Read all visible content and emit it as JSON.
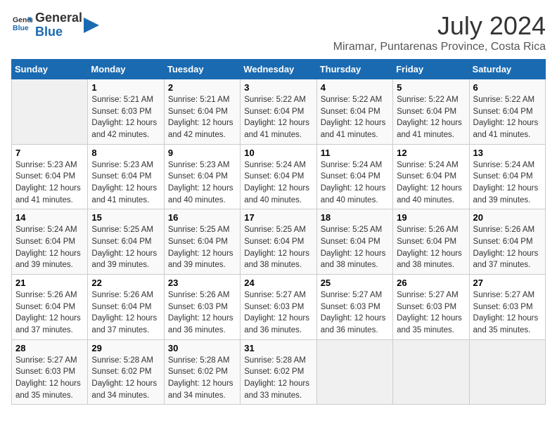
{
  "logo": {
    "line1": "General",
    "line2": "Blue"
  },
  "title": "July 2024",
  "location": "Miramar, Puntarenas Province, Costa Rica",
  "days_of_week": [
    "Sunday",
    "Monday",
    "Tuesday",
    "Wednesday",
    "Thursday",
    "Friday",
    "Saturday"
  ],
  "weeks": [
    [
      {
        "day": "",
        "sunrise": "",
        "sunset": "",
        "daylight": ""
      },
      {
        "day": "1",
        "sunrise": "Sunrise: 5:21 AM",
        "sunset": "Sunset: 6:03 PM",
        "daylight": "Daylight: 12 hours and 42 minutes."
      },
      {
        "day": "2",
        "sunrise": "Sunrise: 5:21 AM",
        "sunset": "Sunset: 6:04 PM",
        "daylight": "Daylight: 12 hours and 42 minutes."
      },
      {
        "day": "3",
        "sunrise": "Sunrise: 5:22 AM",
        "sunset": "Sunset: 6:04 PM",
        "daylight": "Daylight: 12 hours and 41 minutes."
      },
      {
        "day": "4",
        "sunrise": "Sunrise: 5:22 AM",
        "sunset": "Sunset: 6:04 PM",
        "daylight": "Daylight: 12 hours and 41 minutes."
      },
      {
        "day": "5",
        "sunrise": "Sunrise: 5:22 AM",
        "sunset": "Sunset: 6:04 PM",
        "daylight": "Daylight: 12 hours and 41 minutes."
      },
      {
        "day": "6",
        "sunrise": "Sunrise: 5:22 AM",
        "sunset": "Sunset: 6:04 PM",
        "daylight": "Daylight: 12 hours and 41 minutes."
      }
    ],
    [
      {
        "day": "7",
        "sunrise": "Sunrise: 5:23 AM",
        "sunset": "Sunset: 6:04 PM",
        "daylight": "Daylight: 12 hours and 41 minutes."
      },
      {
        "day": "8",
        "sunrise": "Sunrise: 5:23 AM",
        "sunset": "Sunset: 6:04 PM",
        "daylight": "Daylight: 12 hours and 41 minutes."
      },
      {
        "day": "9",
        "sunrise": "Sunrise: 5:23 AM",
        "sunset": "Sunset: 6:04 PM",
        "daylight": "Daylight: 12 hours and 40 minutes."
      },
      {
        "day": "10",
        "sunrise": "Sunrise: 5:24 AM",
        "sunset": "Sunset: 6:04 PM",
        "daylight": "Daylight: 12 hours and 40 minutes."
      },
      {
        "day": "11",
        "sunrise": "Sunrise: 5:24 AM",
        "sunset": "Sunset: 6:04 PM",
        "daylight": "Daylight: 12 hours and 40 minutes."
      },
      {
        "day": "12",
        "sunrise": "Sunrise: 5:24 AM",
        "sunset": "Sunset: 6:04 PM",
        "daylight": "Daylight: 12 hours and 40 minutes."
      },
      {
        "day": "13",
        "sunrise": "Sunrise: 5:24 AM",
        "sunset": "Sunset: 6:04 PM",
        "daylight": "Daylight: 12 hours and 39 minutes."
      }
    ],
    [
      {
        "day": "14",
        "sunrise": "Sunrise: 5:24 AM",
        "sunset": "Sunset: 6:04 PM",
        "daylight": "Daylight: 12 hours and 39 minutes."
      },
      {
        "day": "15",
        "sunrise": "Sunrise: 5:25 AM",
        "sunset": "Sunset: 6:04 PM",
        "daylight": "Daylight: 12 hours and 39 minutes."
      },
      {
        "day": "16",
        "sunrise": "Sunrise: 5:25 AM",
        "sunset": "Sunset: 6:04 PM",
        "daylight": "Daylight: 12 hours and 39 minutes."
      },
      {
        "day": "17",
        "sunrise": "Sunrise: 5:25 AM",
        "sunset": "Sunset: 6:04 PM",
        "daylight": "Daylight: 12 hours and 38 minutes."
      },
      {
        "day": "18",
        "sunrise": "Sunrise: 5:25 AM",
        "sunset": "Sunset: 6:04 PM",
        "daylight": "Daylight: 12 hours and 38 minutes."
      },
      {
        "day": "19",
        "sunrise": "Sunrise: 5:26 AM",
        "sunset": "Sunset: 6:04 PM",
        "daylight": "Daylight: 12 hours and 38 minutes."
      },
      {
        "day": "20",
        "sunrise": "Sunrise: 5:26 AM",
        "sunset": "Sunset: 6:04 PM",
        "daylight": "Daylight: 12 hours and 37 minutes."
      }
    ],
    [
      {
        "day": "21",
        "sunrise": "Sunrise: 5:26 AM",
        "sunset": "Sunset: 6:04 PM",
        "daylight": "Daylight: 12 hours and 37 minutes."
      },
      {
        "day": "22",
        "sunrise": "Sunrise: 5:26 AM",
        "sunset": "Sunset: 6:04 PM",
        "daylight": "Daylight: 12 hours and 37 minutes."
      },
      {
        "day": "23",
        "sunrise": "Sunrise: 5:26 AM",
        "sunset": "Sunset: 6:03 PM",
        "daylight": "Daylight: 12 hours and 36 minutes."
      },
      {
        "day": "24",
        "sunrise": "Sunrise: 5:27 AM",
        "sunset": "Sunset: 6:03 PM",
        "daylight": "Daylight: 12 hours and 36 minutes."
      },
      {
        "day": "25",
        "sunrise": "Sunrise: 5:27 AM",
        "sunset": "Sunset: 6:03 PM",
        "daylight": "Daylight: 12 hours and 36 minutes."
      },
      {
        "day": "26",
        "sunrise": "Sunrise: 5:27 AM",
        "sunset": "Sunset: 6:03 PM",
        "daylight": "Daylight: 12 hours and 35 minutes."
      },
      {
        "day": "27",
        "sunrise": "Sunrise: 5:27 AM",
        "sunset": "Sunset: 6:03 PM",
        "daylight": "Daylight: 12 hours and 35 minutes."
      }
    ],
    [
      {
        "day": "28",
        "sunrise": "Sunrise: 5:27 AM",
        "sunset": "Sunset: 6:03 PM",
        "daylight": "Daylight: 12 hours and 35 minutes."
      },
      {
        "day": "29",
        "sunrise": "Sunrise: 5:28 AM",
        "sunset": "Sunset: 6:02 PM",
        "daylight": "Daylight: 12 hours and 34 minutes."
      },
      {
        "day": "30",
        "sunrise": "Sunrise: 5:28 AM",
        "sunset": "Sunset: 6:02 PM",
        "daylight": "Daylight: 12 hours and 34 minutes."
      },
      {
        "day": "31",
        "sunrise": "Sunrise: 5:28 AM",
        "sunset": "Sunset: 6:02 PM",
        "daylight": "Daylight: 12 hours and 33 minutes."
      },
      {
        "day": "",
        "sunrise": "",
        "sunset": "",
        "daylight": ""
      },
      {
        "day": "",
        "sunrise": "",
        "sunset": "",
        "daylight": ""
      },
      {
        "day": "",
        "sunrise": "",
        "sunset": "",
        "daylight": ""
      }
    ]
  ]
}
